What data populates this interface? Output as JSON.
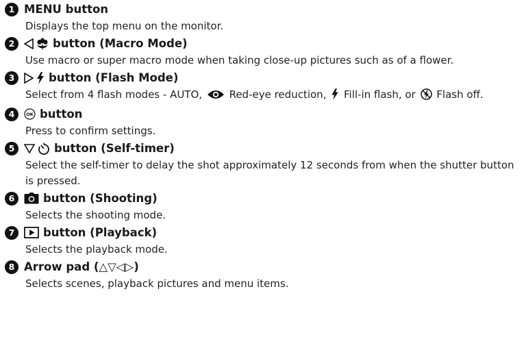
{
  "items": [
    {
      "number": "1",
      "title": "MENU button",
      "desc": "Displays the top menu on the monitor."
    },
    {
      "number": "2",
      "title": "button (Macro Mode)",
      "desc": "Use macro or super macro mode when taking close-up pictures such as of a flower.",
      "icons": [
        "left-triangle-icon",
        "macro-flower-icon"
      ]
    },
    {
      "number": "3",
      "title": "button (Flash Mode)",
      "desc_parts": [
        "Select from 4 flash modes - AUTO,",
        "Red-eye reduction,",
        "Fill-in flash, or",
        "Flash off."
      ],
      "icons": [
        "right-triangle-icon",
        "flash-icon",
        "red-eye-icon",
        "flash-off-icon"
      ]
    },
    {
      "number": "4",
      "title": "button",
      "desc": "Press to confirm settings.",
      "icons": [
        "ok-button-icon"
      ]
    },
    {
      "number": "5",
      "title": "button (Self-timer)",
      "desc": "Select the self-timer to delay the shot approximately 12 seconds from when the shutter button is pressed.",
      "icons": [
        "down-triangle-icon",
        "self-timer-icon"
      ]
    },
    {
      "number": "6",
      "title": "button (Shooting)",
      "desc": "Selects the shooting mode.",
      "icons": [
        "camera-icon"
      ]
    },
    {
      "number": "7",
      "title": "button (Playback)",
      "desc": "Selects the playback mode.",
      "icons": [
        "playback-icon"
      ]
    },
    {
      "number": "8",
      "title": "Arrow pad (",
      "title_glyphs": "△▽◁▷",
      "title_end": ")",
      "desc": "Selects scenes, playback pictures and menu items."
    }
  ],
  "numbers": [
    "❶",
    "❷",
    "❸",
    "❹",
    "❺",
    "❻",
    "❼",
    "❽"
  ]
}
